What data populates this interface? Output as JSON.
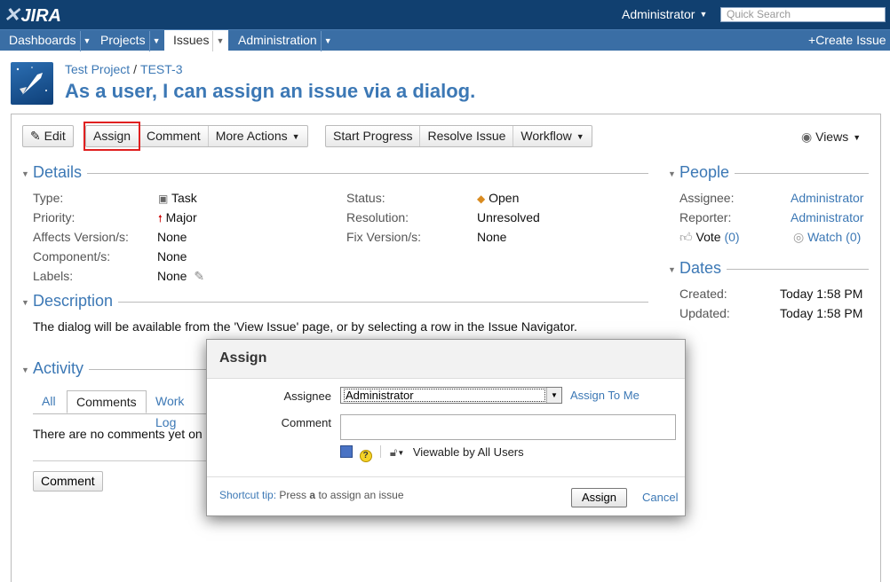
{
  "header": {
    "logo_text": "JIRA",
    "user": "Administrator",
    "quick_search_placeholder": "Quick Search"
  },
  "nav": {
    "items": [
      {
        "label": "Dashboards"
      },
      {
        "label": "Projects"
      },
      {
        "label": "Issues"
      },
      {
        "label": "Administration"
      }
    ],
    "active": "Issues",
    "create_issue": "Create Issue"
  },
  "issue": {
    "project": "Test Project",
    "key": "TEST-3",
    "title": "As a user, I can assign an issue via a dialog."
  },
  "toolbar": {
    "edit": "Edit",
    "assign": "Assign",
    "comment": "Comment",
    "more_actions": "More Actions",
    "start_progress": "Start Progress",
    "resolve_issue": "Resolve Issue",
    "workflow": "Workflow",
    "views": "Views"
  },
  "details": {
    "heading": "Details",
    "type_label": "Type:",
    "type_value": "Task",
    "priority_label": "Priority:",
    "priority_value": "Major",
    "affects_label": "Affects Version/s:",
    "affects_value": "None",
    "component_label": "Component/s:",
    "component_value": "None",
    "labels_label": "Labels:",
    "labels_value": "None",
    "status_label": "Status:",
    "status_value": "Open",
    "resolution_label": "Resolution:",
    "resolution_value": "Unresolved",
    "fix_label": "Fix Version/s:",
    "fix_value": "None"
  },
  "description": {
    "heading": "Description",
    "text": "The dialog will be available from the 'View Issue' page, or by selecting a row in the Issue Navigator."
  },
  "activity": {
    "heading": "Activity",
    "tabs": [
      "All",
      "Comments",
      "Work Log"
    ],
    "active_tab": "Comments",
    "empty_text": "There are no comments yet on",
    "comment_button": "Comment"
  },
  "people": {
    "heading": "People",
    "assignee_label": "Assignee:",
    "assignee_value": "Administrator",
    "reporter_label": "Reporter:",
    "reporter_value": "Administrator",
    "vote_label": "Vote",
    "vote_count": "(0)",
    "watch_label": "Watch",
    "watch_count": "(0)"
  },
  "dates": {
    "heading": "Dates",
    "created_label": "Created:",
    "created_value": "Today 1:58 PM",
    "updated_label": "Updated:",
    "updated_value": "Today 1:58 PM"
  },
  "dialog": {
    "title": "Assign",
    "assignee_label": "Assignee",
    "assignee_selected": "Administrator",
    "assign_to_me": "Assign To Me",
    "comment_label": "Comment",
    "comment_value": "",
    "visibility": "Viewable by All Users",
    "shortcut_label": "Shortcut tip:",
    "shortcut_pre": "Press",
    "shortcut_key": "a",
    "shortcut_post": "to assign an issue",
    "assign_button": "Assign",
    "cancel": "Cancel"
  },
  "colors": {
    "header_bg": "#114070",
    "nav_bg": "#3a6ea5",
    "link": "#3c78b5",
    "highlight": "#e02020"
  }
}
